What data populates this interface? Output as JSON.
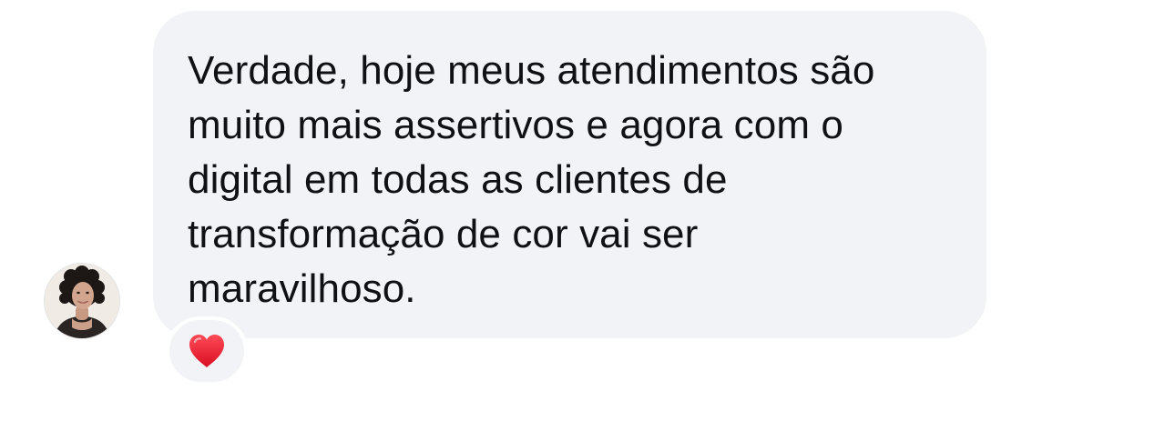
{
  "message": {
    "lines": [
      "Verdade, hoje meus atendimentos são",
      "muito mais assertivos e agora com o",
      "digital em todas as clientes de",
      "transformação de cor vai ser",
      "maravilhoso."
    ]
  },
  "reaction": {
    "icon": "red-heart-icon",
    "color": "#e3132b"
  },
  "colors": {
    "bubble": "#f2f3f6",
    "text": "#101114",
    "background": "#ffffff"
  }
}
